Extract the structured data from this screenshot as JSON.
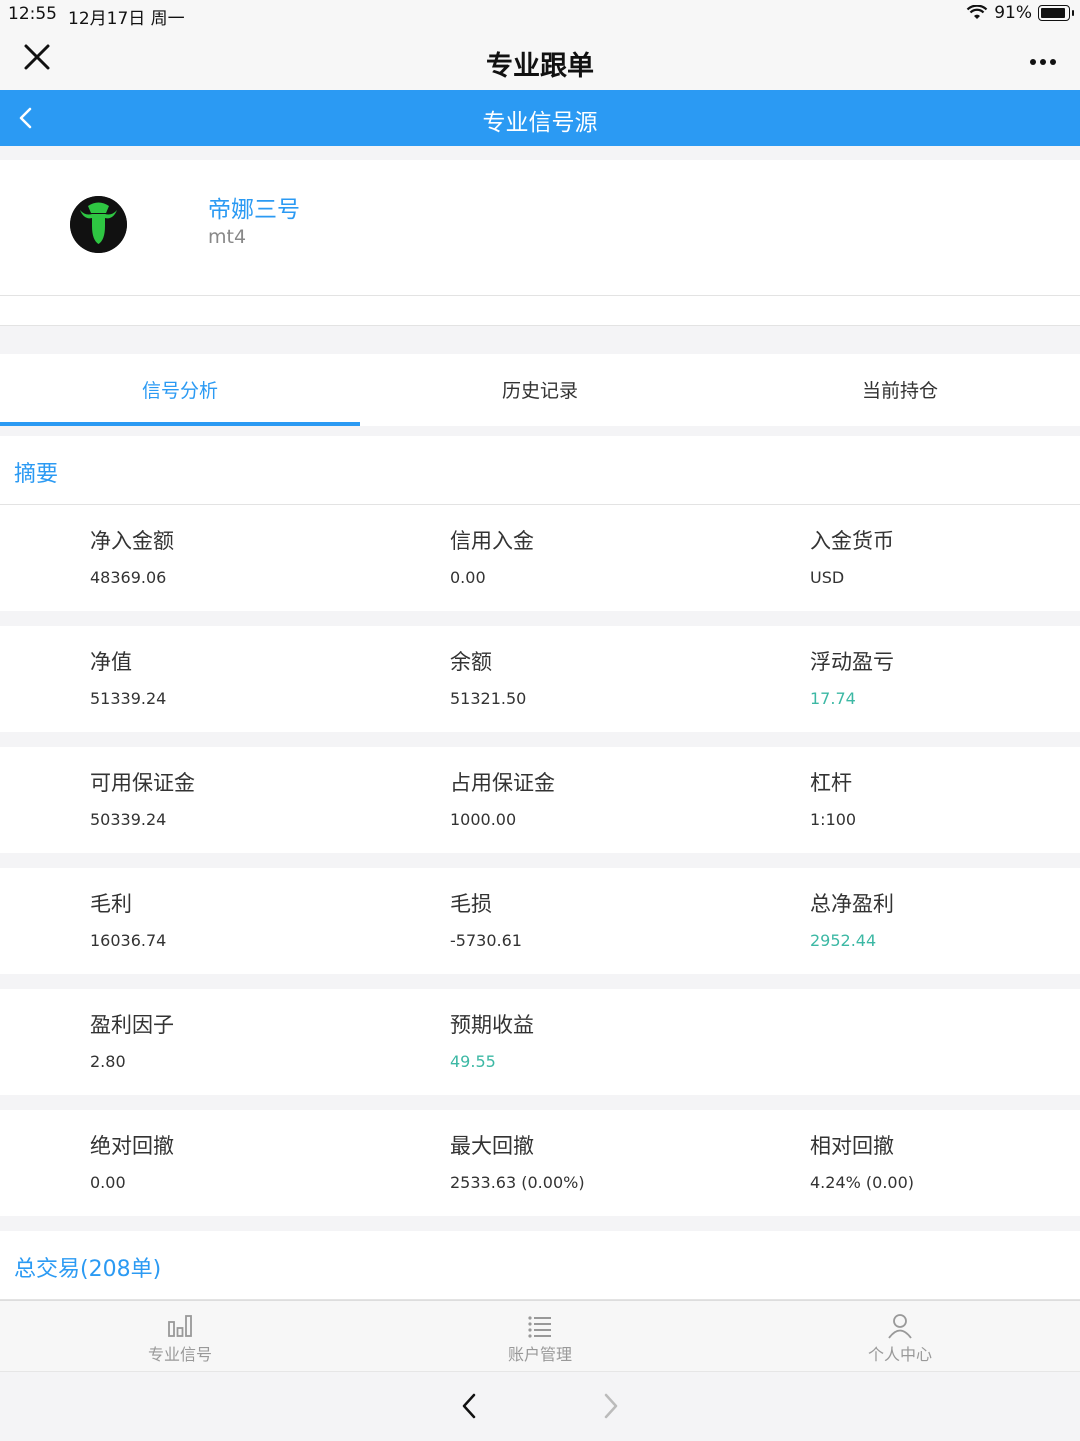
{
  "status": {
    "time": "12:55",
    "date": "12月17日 周一",
    "battery": "91%"
  },
  "nav": {
    "title": "专业跟单"
  },
  "subnav": {
    "title": "专业信号源"
  },
  "profile": {
    "name": "帝娜三号",
    "platform": "mt4"
  },
  "tabs": [
    "信号分析",
    "历史记录",
    "当前持仓"
  ],
  "summary": {
    "title": "摘要",
    "rows": [
      [
        {
          "label": "净入金额",
          "value": "48369.06"
        },
        {
          "label": "信用入金",
          "value": "0.00"
        },
        {
          "label": "入金货币",
          "value": "USD"
        }
      ],
      [
        {
          "label": "净值",
          "value": "51339.24"
        },
        {
          "label": "余额",
          "value": "51321.50"
        },
        {
          "label": "浮动盈亏",
          "value": "17.74"
        }
      ],
      [
        {
          "label": "可用保证金",
          "value": "50339.24"
        },
        {
          "label": "占用保证金",
          "value": "1000.00"
        },
        {
          "label": "杠杆",
          "value": "1:100"
        }
      ],
      [
        {
          "label": "毛利",
          "value": "16036.74"
        },
        {
          "label": "毛损",
          "value": "-5730.61"
        },
        {
          "label": "总净盈利",
          "value": "2952.44"
        }
      ],
      [
        {
          "label": "盈利因子",
          "value": "2.80"
        },
        {
          "label": "预期收益",
          "value": "49.55"
        }
      ],
      [
        {
          "label": "绝对回撤",
          "value": "0.00"
        },
        {
          "label": "最大回撤",
          "value": "2533.63 (0.00%)"
        },
        {
          "label": "相对回撤",
          "value": "4.24% (0.00)"
        }
      ]
    ]
  },
  "trades": {
    "title": "总交易(208单)"
  },
  "bottom_nav": [
    "专业信号",
    "账户管理",
    "个人中心"
  ],
  "colors": {
    "accent": "#2b9af3",
    "positive": "#3cb8a4"
  }
}
